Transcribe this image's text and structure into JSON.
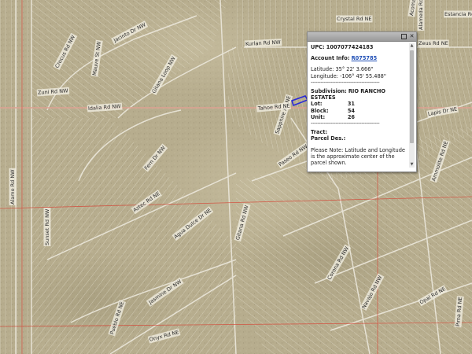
{
  "map": {
    "street_labels": [
      {
        "text": "Crystal Rd NE"
      },
      {
        "text": "Alameda Rd NE"
      },
      {
        "text": "Estancia Rd NE"
      },
      {
        "text": "Kurlan Rd NW"
      },
      {
        "text": "Jacinto Dr NW"
      },
      {
        "text": "Acoma Rd NE"
      },
      {
        "text": "Zeus Rd NE"
      },
      {
        "text": "Lapis Dr NE"
      },
      {
        "text": "Ammolite Rd NE"
      },
      {
        "text": "Crocus Rd NW"
      },
      {
        "text": "Mauve St NW"
      },
      {
        "text": "Gitana Loop NW"
      },
      {
        "text": "Zuni Rd NW"
      },
      {
        "text": "Sapphire Rd NE"
      },
      {
        "text": "Idalia Rd NW"
      },
      {
        "text": "Tahoe Rd NE"
      },
      {
        "text": "Paseo Rd NW"
      },
      {
        "text": "Fern Dr NW"
      },
      {
        "text": "Alamo Rd NW"
      },
      {
        "text": "Aztec Rd NE"
      },
      {
        "text": "Sunset Rd NW"
      },
      {
        "text": "Agua Dulce Dr NE"
      },
      {
        "text": "Gitana Rd NW"
      },
      {
        "text": "Corona Rd NW"
      },
      {
        "text": "Navajo Rd NW"
      },
      {
        "text": "Jasmine Dr NW"
      },
      {
        "text": "Opal Rd NE"
      },
      {
        "text": "Pueblo Rd NE"
      },
      {
        "text": "Onyx Rd NE"
      },
      {
        "text": "Pima Rd NE"
      }
    ],
    "colors": {
      "imagery_base": "#b7ad8e",
      "parcel_line": "#f2efe5",
      "section_line": "#d44a3a",
      "selected_parcel": "#2a2ad8"
    }
  },
  "popup": {
    "upc_label": "UPC:",
    "upc_value": "1007077424183",
    "account_label": "Account Info:",
    "account_value": "R075785",
    "latitude_label": "Latitude:",
    "latitude_value": "35° 22' 3.666\"",
    "longitude_label": "Longitude:",
    "longitude_value": "-106° 45' 55.488\"",
    "separator": "------------------------------------------",
    "subdivision_label": "Subdivision:",
    "subdivision_value": "RIO RANCHO",
    "subdivision_value_2": "ESTATES",
    "lot_label": "Lot:",
    "lot_value": "31",
    "block_label": "Block:",
    "block_value": "54",
    "unit_label": "Unit:",
    "unit_value": "26",
    "tract_label": "Tract:",
    "parcel_des_label": "Parcel Des.:",
    "note": "Please Note: Latitude and Longitude is the approximate center of the parcel shown.",
    "maximize_icon": "maximize-icon",
    "close_icon": "close-icon",
    "close_glyph": "✕"
  }
}
